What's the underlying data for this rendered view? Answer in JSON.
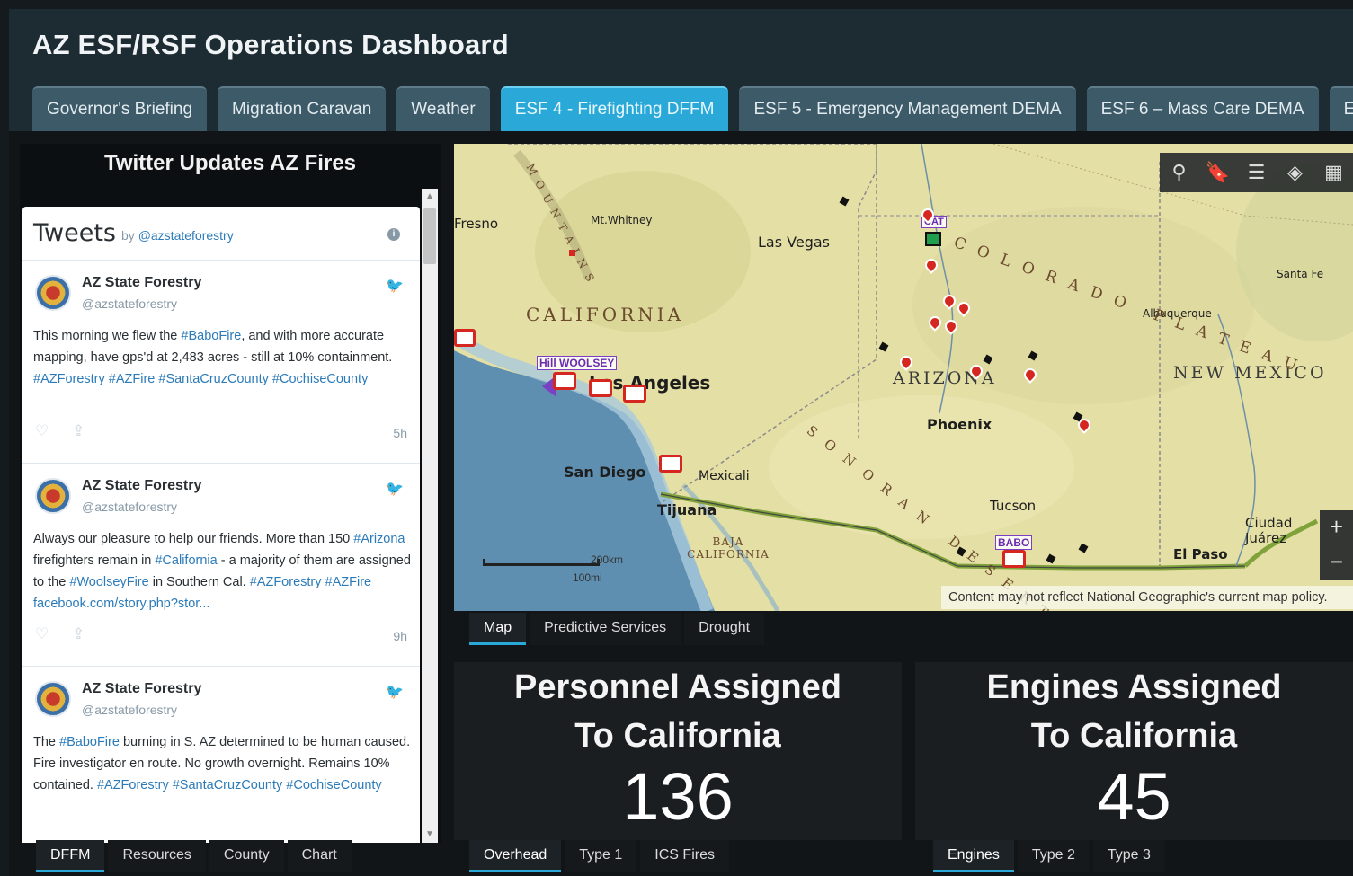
{
  "app": {
    "title": "AZ ESF/RSF Operations Dashboard",
    "tabs": [
      {
        "label": "Governor's Briefing",
        "active": false
      },
      {
        "label": "Migration Caravan",
        "active": false
      },
      {
        "label": "Weather",
        "active": false
      },
      {
        "label": "ESF 4 - Firefighting DFFM",
        "active": true
      },
      {
        "label": "ESF 5 - Emergency Management DEMA",
        "active": false
      },
      {
        "label": "ESF 6 – Mass Care DEMA",
        "active": false
      },
      {
        "label": "ES",
        "active": false
      }
    ]
  },
  "twitter_panel": {
    "title": "Twitter Updates AZ Fires",
    "heading": "Tweets",
    "by_prefix": "by",
    "by_handle": "@azstateforestry",
    "info_glyph": "i",
    "bird_glyph": "🐦",
    "tweets": [
      {
        "name": "AZ State Forestry",
        "handle": "@azstateforestry",
        "segments": [
          {
            "t": "This morning we flew the ",
            "h": false
          },
          {
            "t": "#BaboFire",
            "h": true
          },
          {
            "t": ", and with more accurate mapping,  have gps'd at 2,483 acres - still at 10% containment. ",
            "h": false
          },
          {
            "t": "#AZForestry #AZFire #SantaCruzCounty #CochiseCounty",
            "h": true
          }
        ],
        "time": "5h"
      },
      {
        "name": "AZ State Forestry",
        "handle": "@azstateforestry",
        "segments": [
          {
            "t": "Always our pleasure to help our friends. More than 150 ",
            "h": false
          },
          {
            "t": "#Arizona",
            "h": true
          },
          {
            "t": " firefighters remain in ",
            "h": false
          },
          {
            "t": "#California",
            "h": true
          },
          {
            "t": " - a majority of them are assigned to the ",
            "h": false
          },
          {
            "t": "#WoolseyFire",
            "h": true
          },
          {
            "t": " in Southern Cal. ",
            "h": false
          },
          {
            "t": "#AZForestry #AZFire facebook.com/story.php?stor...",
            "h": true
          }
        ],
        "time": "9h"
      },
      {
        "name": "AZ State Forestry",
        "handle": "@azstateforestry",
        "segments": [
          {
            "t": "The ",
            "h": false
          },
          {
            "t": "#BaboFire",
            "h": true
          },
          {
            "t": " burning in S. AZ determined to be human caused. Fire investigator en route. No growth overnight. Remains 10% contained. ",
            "h": false
          },
          {
            "t": "#AZForestry #SantaCruzCounty #CochiseCounty",
            "h": true
          }
        ],
        "time": ""
      }
    ],
    "sub_tabs": [
      {
        "label": "DFFM",
        "active": true
      },
      {
        "label": "Resources",
        "active": false
      },
      {
        "label": "County",
        "active": false
      },
      {
        "label": "Chart",
        "active": false
      }
    ]
  },
  "map": {
    "toolbar": [
      "search-icon",
      "bookmark-icon",
      "legend-icon",
      "layers-icon",
      "basemap-gallery-icon"
    ],
    "toolbar_glyphs": [
      "⚲",
      "🔖",
      "☰",
      "◈",
      "▦"
    ],
    "zoom_in": "+",
    "zoom_out": "−",
    "credit": "Content may not reflect National Geographic's current map policy.",
    "scale_km": "200km",
    "scale_mi": "100mi",
    "cities": {
      "fresno": "Fresno",
      "mt_whitney": "Mt.Whitney",
      "las_vegas": "Las Vegas",
      "santa_fe": "Santa Fe",
      "albuquerque": "Albuquerque",
      "los_angeles": "Los Angeles",
      "phoenix": "Phoenix",
      "san_diego": "San Diego",
      "mexicali": "Mexicali",
      "tijuana": "Tijuana",
      "tucson": "Tucson",
      "ciudad_juarez": "Ciudad Juárez",
      "el_paso": "El Paso"
    },
    "regions": {
      "california": "CALIFORNIA",
      "arizona": "ARIZONA",
      "new_mexico": "NEW MEXICO",
      "colorado_plateau": "COLORADO PLATEAU",
      "sonoran_desert": "SONORAN DESERT",
      "baja_california": "BAJA CALIFORNIA",
      "sierra": "MOUNTAINS"
    },
    "fire_tags": {
      "hill_woolsey": "Hill WOOLSEY",
      "babo": "BABO",
      "cat": "CAT"
    },
    "sub_tabs": [
      {
        "label": "Map",
        "active": true
      },
      {
        "label": "Predictive Services",
        "active": false
      },
      {
        "label": "Drought",
        "active": false
      }
    ],
    "colors": {
      "land": "#e4dfa5",
      "ocean": "#5e8fb0",
      "coast": "#a9c9dc",
      "border": "#7fa33a",
      "incident": "#d5271f"
    }
  },
  "personnel": {
    "title_line1": "Personnel Assigned",
    "title_line2": "To California",
    "value": "136",
    "sub_tabs": [
      {
        "label": "Overhead",
        "active": true
      },
      {
        "label": "Type 1",
        "active": false
      },
      {
        "label": "ICS Fires",
        "active": false
      }
    ]
  },
  "engines": {
    "title_line1": "Engines Assigned",
    "title_line2": "To California",
    "value": "45",
    "sub_tabs": [
      {
        "label": "Engines",
        "active": true
      },
      {
        "label": "Type 2",
        "active": false
      },
      {
        "label": "Type 3",
        "active": false
      }
    ]
  }
}
